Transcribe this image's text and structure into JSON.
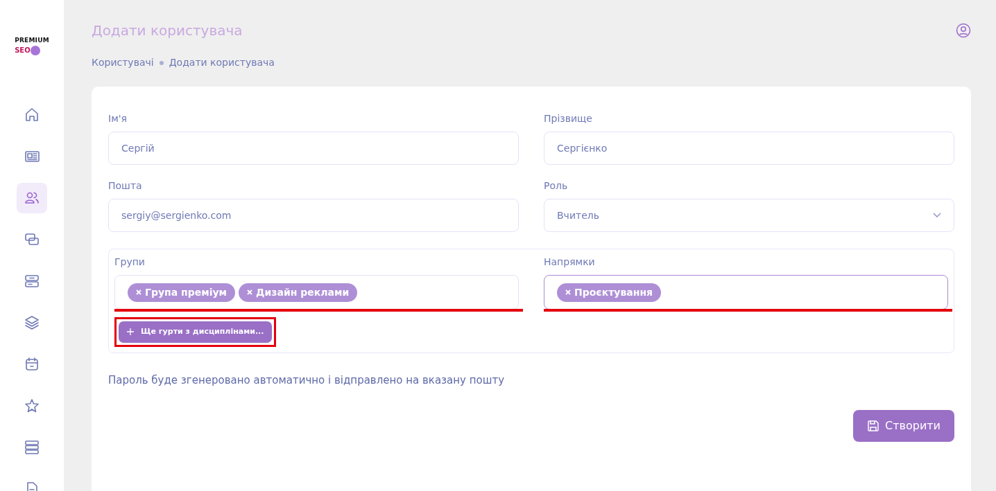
{
  "logo": {
    "line_1": "PREMIUM",
    "line_2": "SEO"
  },
  "sidebar": {
    "items": [
      {
        "kind": "home",
        "selected": false
      },
      {
        "kind": "newspaper",
        "selected": false
      },
      {
        "kind": "users",
        "selected": true
      },
      {
        "kind": "cards",
        "selected": false
      },
      {
        "kind": "server",
        "selected": false
      },
      {
        "kind": "layers",
        "selected": false
      },
      {
        "kind": "calendar",
        "selected": false
      },
      {
        "kind": "star",
        "selected": false
      },
      {
        "kind": "rows",
        "selected": false
      },
      {
        "kind": "document",
        "selected": false
      }
    ]
  },
  "page": {
    "title": "Додати користувача",
    "breadcrumb": [
      "Користувачі",
      "Додати користувача"
    ]
  },
  "form": {
    "fields": [
      {
        "label": "Ім'я",
        "value": "Сергій",
        "kind": "text"
      },
      {
        "label": "Прізвище",
        "value": "Сергієнко",
        "kind": "text"
      },
      {
        "label": "Пошта",
        "value": "sergiy@sergienko.com",
        "kind": "text"
      },
      {
        "label": "Роль",
        "value": "Вчитель",
        "kind": "select"
      }
    ],
    "tag_fields": [
      {
        "label": "Групи",
        "tags": [
          "Група преміум",
          "Дизайн реклами"
        ],
        "focused": false,
        "highlighted": true
      },
      {
        "label": "Напрямки",
        "tags": [
          "Проєктування"
        ],
        "focused": true,
        "highlighted": true
      }
    ],
    "more_button": {
      "label": "Ще гурти з дисциплінами...",
      "highlighted": true
    },
    "note": "Пароль буде згенеровано автоматично і відправлено на вказану пошту",
    "submit": {
      "label": "Створити"
    }
  }
}
